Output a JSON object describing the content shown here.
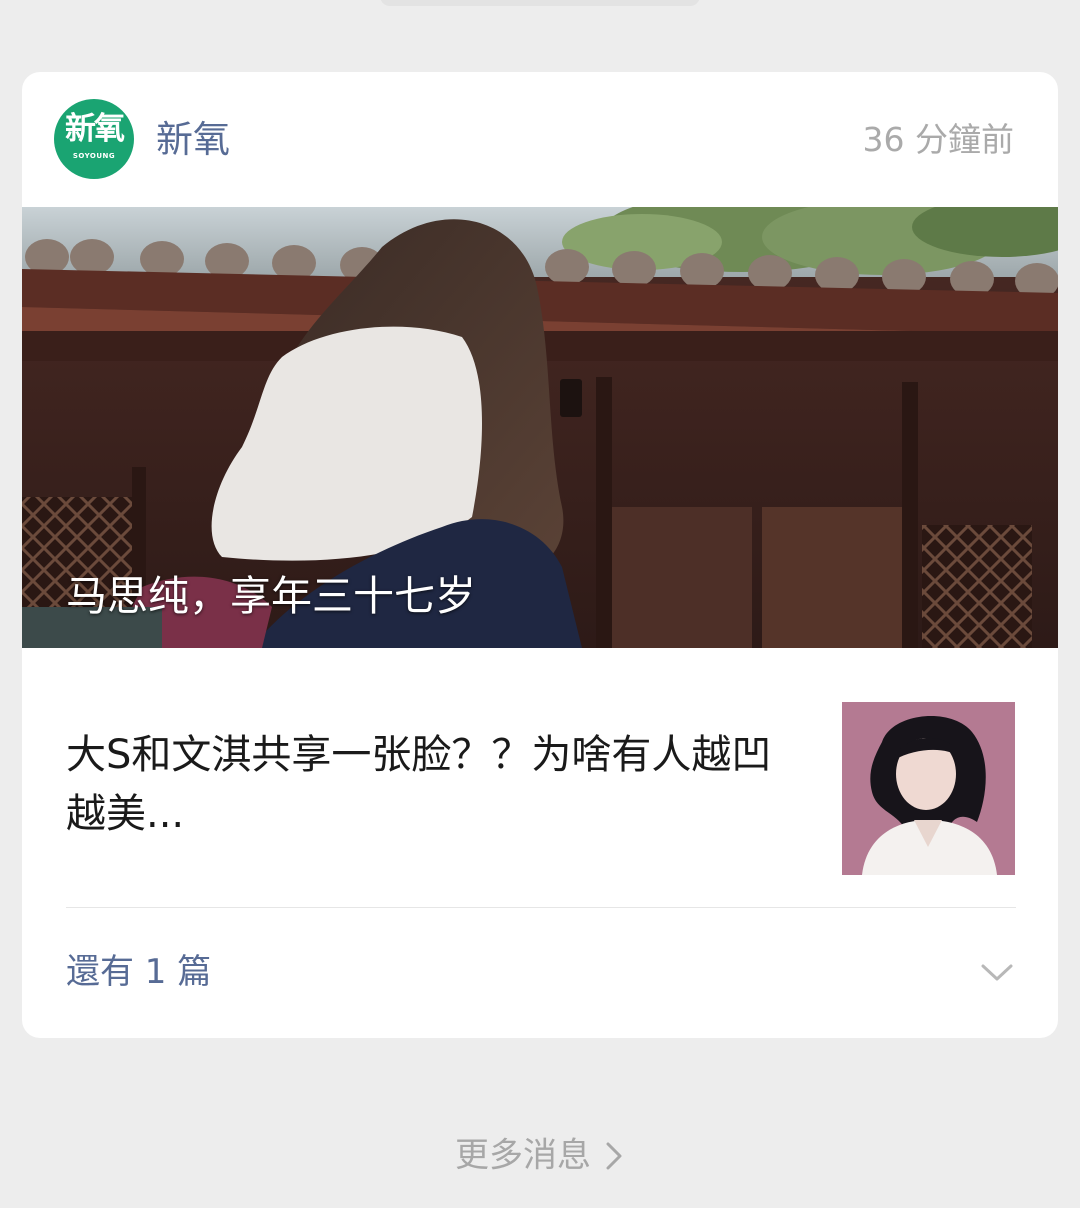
{
  "card": {
    "account_name": "新氧",
    "logo_main": "新氧",
    "logo_sub": "SOYOUNG",
    "timestamp": "36 分鐘前",
    "cover_caption": "马思纯，享年三十七岁",
    "article_title": "大S和文淇共享一张脸？？为啥有人越凹越美...",
    "more_label": "還有 1 篇"
  },
  "footer": {
    "more_messages_label": "更多消息"
  },
  "colors": {
    "page_background": "#ededed",
    "card_background": "#ffffff",
    "link_blue": "#576b95",
    "muted_gray": "#aaaaaa",
    "brand_green": "#1aa472"
  },
  "icons": {
    "expand": "chevron-down-icon",
    "more": "chevron-right-icon"
  }
}
